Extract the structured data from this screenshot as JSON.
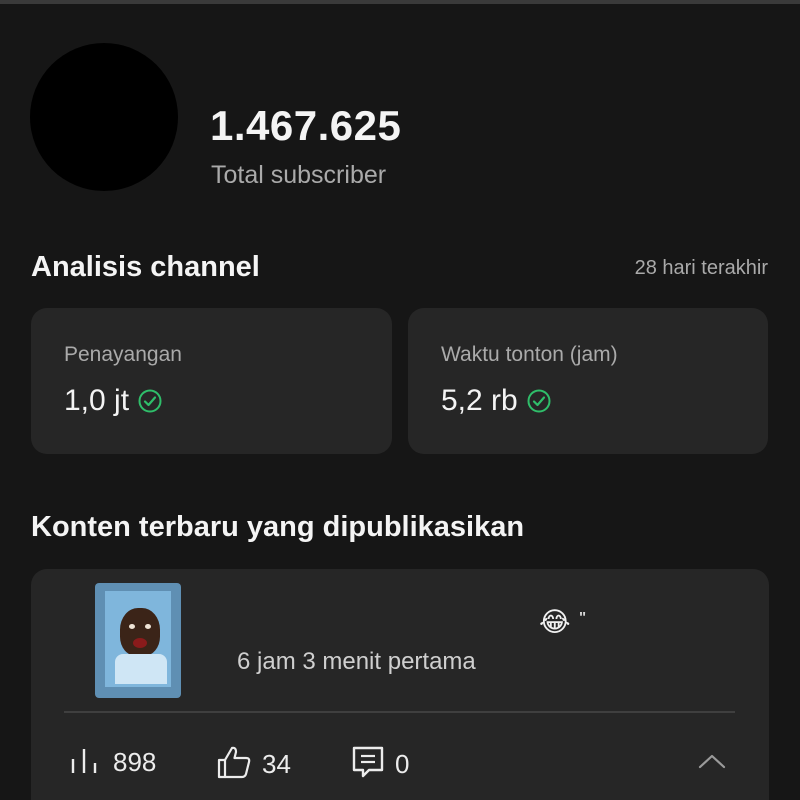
{
  "channel": {
    "subscriber_count": "1.467.625",
    "subscriber_label": "Total subscriber"
  },
  "analytics": {
    "title": "Analisis channel",
    "period": "28 hari terakhir",
    "metrics": [
      {
        "label": "Penayangan",
        "value": "1,0 jt",
        "icon": "check-circle-icon"
      },
      {
        "label": "Waktu tonton (jam)",
        "value": "5,2 rb",
        "icon": "check-circle-icon"
      }
    ]
  },
  "latest_content": {
    "title": "Konten terbaru yang dipublikasikan",
    "item": {
      "title_emoji": "😂",
      "title_suffix": "\"",
      "duration_text": "6 jam 3 menit pertama",
      "views": "898",
      "likes": "34",
      "comments": "0"
    }
  },
  "colors": {
    "background": "#161616",
    "card": "#262626",
    "accent_check": "#2fbe6a",
    "text_secondary": "#aaaaaa"
  }
}
